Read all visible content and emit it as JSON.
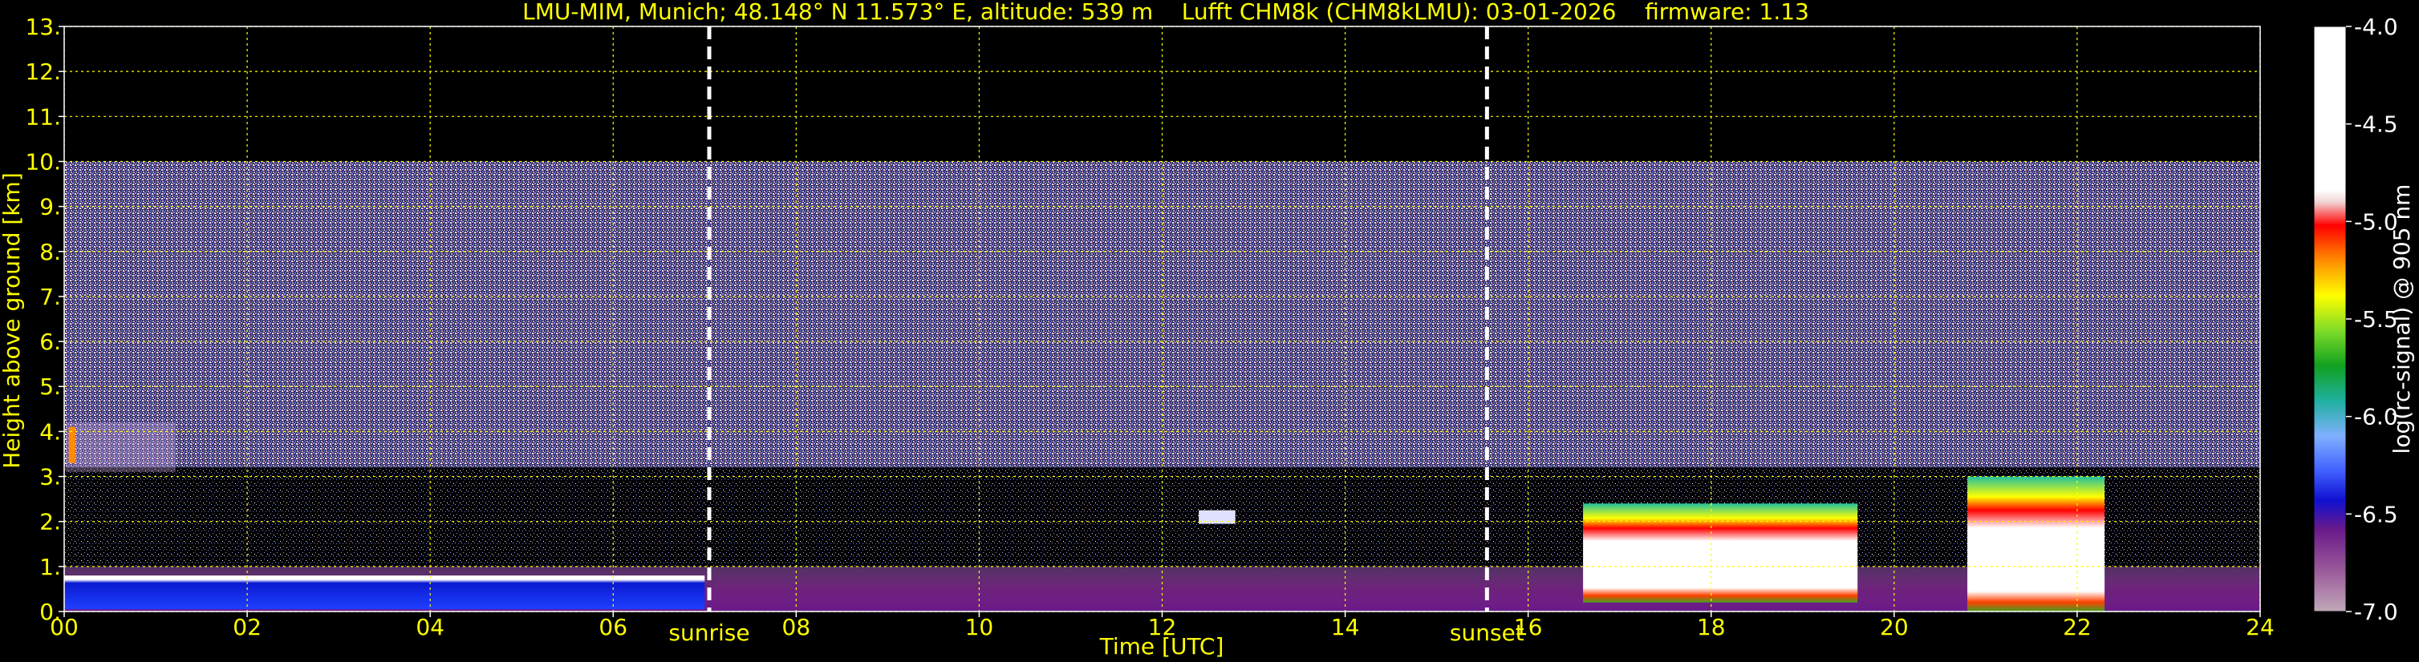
{
  "chart_data": {
    "type": "heatmap",
    "title": "LMU-MIM, Munich; 48.148° N 11.573° E, altitude: 539 m    Lufft CHM8k (CHM8kLMU): 03-01-2026    firmware: 1.13",
    "xlabel": "Time [UTC]",
    "ylabel": "Height above ground [km]",
    "xlim": [
      0,
      24
    ],
    "ylim": [
      0,
      13
    ],
    "x_ticks": [
      "00",
      "02",
      "04",
      "06",
      "08",
      "10",
      "12",
      "14",
      "16",
      "18",
      "20",
      "22",
      "24"
    ],
    "y_ticks": [
      "0.",
      "1.",
      "2.",
      "3.",
      "4.",
      "5.",
      "6.",
      "7.",
      "8.",
      "9.",
      "10.",
      "11.",
      "12.",
      "13."
    ],
    "grid": true,
    "measurement_top_km": 10,
    "markers": [
      {
        "label": "sunrise",
        "time_h": 7.05
      },
      {
        "label": "sunset",
        "time_h": 15.55
      }
    ],
    "colorbar": {
      "label": "log(rc-signal) @ 905 nm",
      "range": [
        -7.0,
        -4.0
      ],
      "ticks": [
        "-4.0",
        "-4.5",
        "-5.0",
        "-5.5",
        "-6.0",
        "-6.5",
        "-7.0"
      ]
    },
    "features": [
      {
        "name": "boundary layer aerosol",
        "t_start": 0,
        "t_end": 24,
        "top_km": 1.0
      },
      {
        "name": "low cloud layer",
        "t_start": 0,
        "t_end": 7.0,
        "height_km": 0.75
      },
      {
        "name": "elevated layer",
        "t_start": 0,
        "t_end": 1.2,
        "height_km": 3.8
      },
      {
        "name": "thin cloud",
        "t_start": 12.4,
        "t_end": 12.8,
        "height_km": 2.1
      },
      {
        "name": "cloud deck",
        "t_start": 16.6,
        "t_end": 19.6,
        "base_km": 0.2,
        "top_km": 2.4
      },
      {
        "name": "cloud deck",
        "t_start": 20.8,
        "t_end": 22.3,
        "base_km": 0.0,
        "top_km": 3.0
      }
    ]
  },
  "colors": {
    "axis_text": "#ffff00",
    "grid": "#ffff00",
    "background": "#000000",
    "colorbar_text": "#ffffff"
  }
}
